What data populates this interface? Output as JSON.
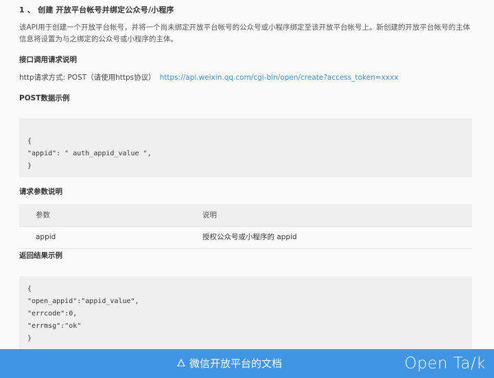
{
  "doc": {
    "heading": "1 、 创建 开放平台帐号并绑定公众号/小程序",
    "description": "该API用于创建一个开放平台帐号，并将一个尚未绑定开放平台帐号的公众号或小程序绑定至该开放平台帐号上。新创建的开放平台帐号的主体信息将设置为与之绑定的公众号或小程序的主体。",
    "section_interface": "接口调用请求说明",
    "request_method_label": "http请求方式: POST（请使用https协议）",
    "request_url": "https://api.weixin.qq.com/cgi-bin/open/create?access_token=xxxx",
    "section_post_example": "POST数据示例",
    "post_example_lines": [
      "{",
      "\"appid\": \" auth_appid_value \",",
      "}"
    ],
    "section_params": "请求参数说明",
    "params_table": {
      "headers": [
        "参数",
        "说明"
      ],
      "rows": [
        [
          "appid",
          "授权公众号或小程序的 appid"
        ]
      ]
    },
    "section_result": "返回结果示例",
    "result_example_lines": [
      "{",
      "\"open_appid\":\"appid_value\",",
      "\"errcode\":0,",
      "\"errmsg\":\"ok\"",
      "}"
    ]
  },
  "banner": {
    "caption": "微信开放平台的文档",
    "brand": "Open Ta/k",
    "background_color": "#3f95e3"
  }
}
